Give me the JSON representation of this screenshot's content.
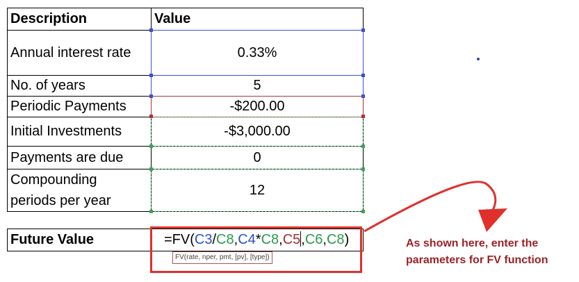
{
  "table": {
    "header": {
      "description": "Description",
      "value": "Value"
    },
    "rows": [
      {
        "description": "Annual interest rate",
        "value": "0.33%"
      },
      {
        "description": "No. of years",
        "value": "5"
      },
      {
        "description": "Periodic Payments",
        "value": "-$200.00"
      },
      {
        "description": "Initial Investments",
        "value": "-$3,000.00"
      },
      {
        "description": "Payments are due",
        "value": "0"
      },
      {
        "description_line1": "Compounding",
        "description_line2": "periods per year",
        "value": "12"
      }
    ]
  },
  "future_value": {
    "label": "Future Value",
    "formula_parts": {
      "prefix": "=FV(",
      "c3": "C3",
      "slash": "/",
      "c8a": "C8",
      "comma1": ",",
      "c4": "C4",
      "star": "*",
      "c8b": "C8",
      "comma2": ",",
      "c5": "C5",
      "comma3": ",",
      "c6": "C6",
      "comma4": ",",
      "c8c": "C8",
      "suffix": ")"
    },
    "tooltip": "FV(rate, nper, pmt, [pv], [type])"
  },
  "annotation": {
    "line1": "As shown here, enter the",
    "line2": "parameters for FV function"
  },
  "colors": {
    "ref_blue": "#2a4fd0",
    "ref_green": "#2a9a4a",
    "ref_red": "#a03030",
    "arrow_red": "#e0302c",
    "note_red": "#9b2226"
  }
}
